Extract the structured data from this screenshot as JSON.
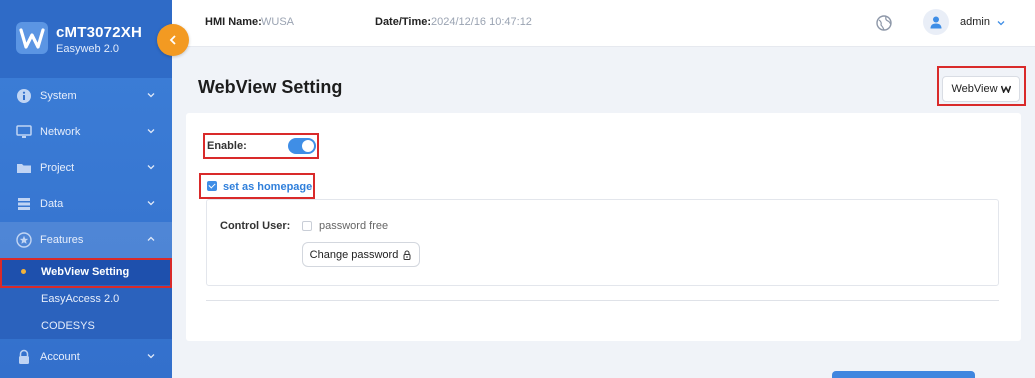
{
  "brand": {
    "title": "cMT3072XH",
    "subtitle": "Easyweb 2.0"
  },
  "header": {
    "hmi_label": "HMI Name:",
    "hmi_value": "WUSA",
    "datetime_label": "Date/Time:",
    "datetime_value": "2024/12/16 10:47:12",
    "user": "admin"
  },
  "sidebar": {
    "items": [
      {
        "label": "System",
        "icon": "info-icon"
      },
      {
        "label": "Network",
        "icon": "network-icon"
      },
      {
        "label": "Project",
        "icon": "folder-icon"
      },
      {
        "label": "Data",
        "icon": "database-icon"
      },
      {
        "label": "Features",
        "icon": "star-icon"
      }
    ],
    "features_sub": [
      {
        "label": "WebView Setting"
      },
      {
        "label": "EasyAccess 2.0"
      },
      {
        "label": "CODESYS"
      }
    ],
    "account": {
      "label": "Account",
      "icon": "lock-icon"
    }
  },
  "main": {
    "title": "WebView Setting",
    "webview_button": "WebView",
    "enable_label": "Enable:",
    "homepage_label": "set as homepage",
    "control_user_label": "Control User:",
    "password_free_label": "password free",
    "change_password_label": "Change password"
  },
  "colors": {
    "accent": "#3f8ee6",
    "sidebar": "#3370cc",
    "orange": "#f39a22",
    "highlight": "#d92a2a"
  }
}
